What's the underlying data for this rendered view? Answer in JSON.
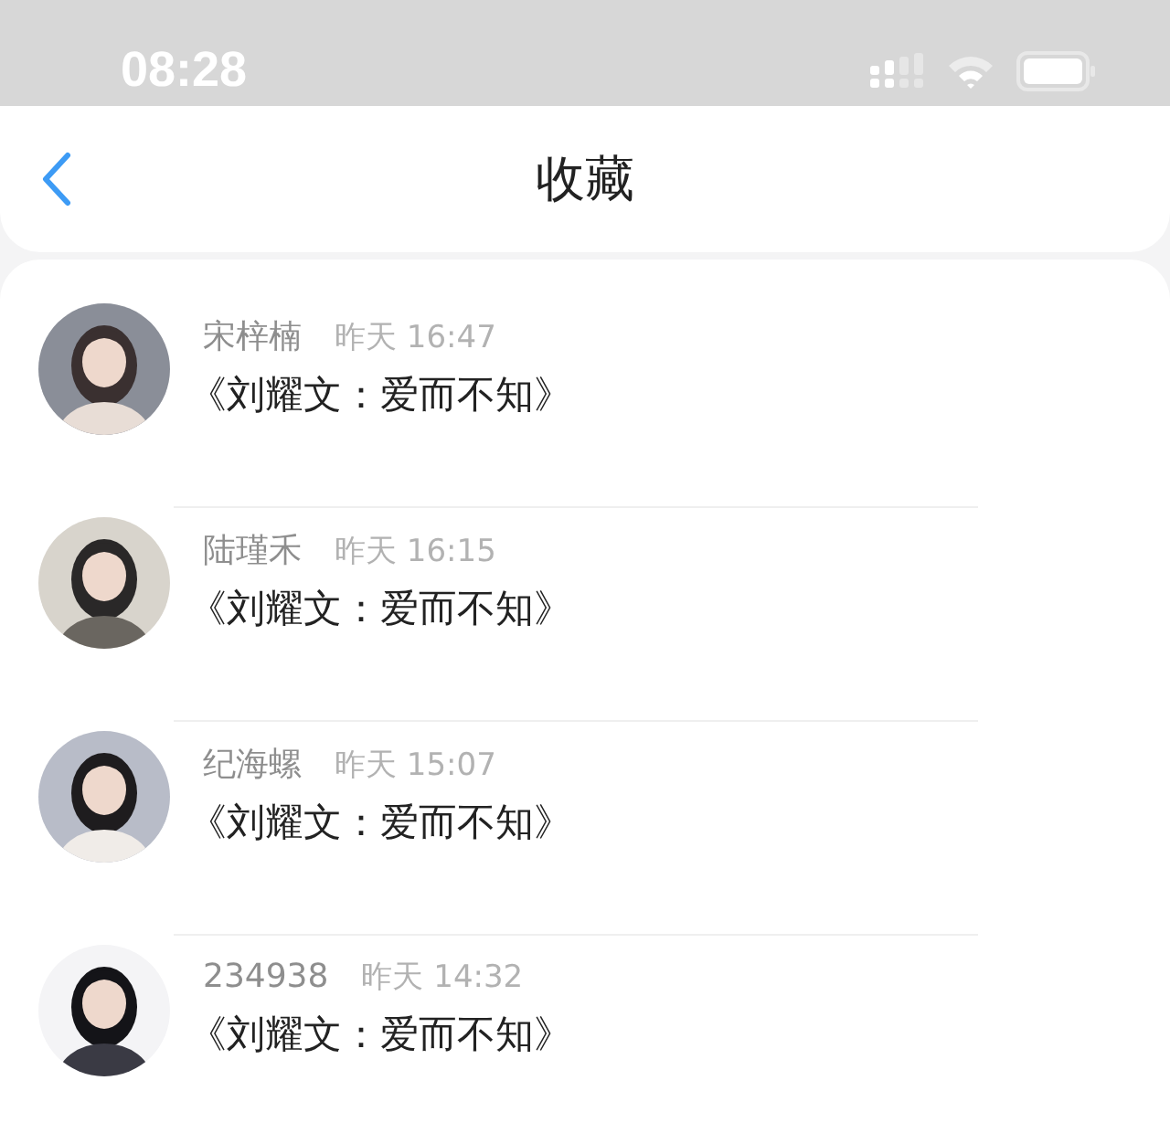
{
  "status_bar": {
    "time": "08:28"
  },
  "header": {
    "title": "收藏"
  },
  "items": [
    {
      "name": "宋梓楠",
      "time": "昨天 16:47",
      "title": "《刘耀文：爱而不知》"
    },
    {
      "name": "陆瑾禾",
      "time": "昨天 16:15",
      "title": "《刘耀文：爱而不知》"
    },
    {
      "name": "纪海螺",
      "time": "昨天 15:07",
      "title": "《刘耀文：爱而不知》"
    },
    {
      "name": "234938",
      "time": "昨天 14:32",
      "title": "《刘耀文：爱而不知》"
    }
  ]
}
